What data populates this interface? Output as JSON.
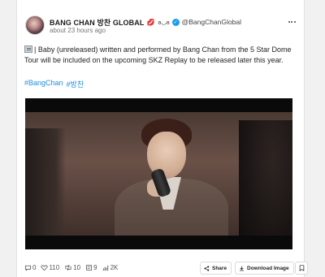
{
  "post": {
    "author": {
      "name": "BANG CHAN 방찬 GLOBAL",
      "lips_emoji": "💋",
      "name_suffix": "ʚ◡ɞ",
      "handle": "@BangChanGlobal"
    },
    "timestamp": "about 23 hours ago",
    "text": "| Baby (unreleased) written and performed by Bang Chan from the 5 Star Dome Tour will be included on the upcoming SKZ Replay to be released later this year.",
    "hashtags": [
      "#BangChan",
      "#방찬"
    ]
  },
  "stats": {
    "replies": "0",
    "likes": "110",
    "reposts": "10",
    "quotes": "9",
    "views": "2K"
  },
  "buttons": {
    "share": "Share",
    "download": "Download Image"
  },
  "colors": {
    "accent": "#1d8fe0",
    "verified": "#1d9bf0"
  },
  "icons": [
    "avatar",
    "lips-icon",
    "verified-icon",
    "more-icon",
    "newspaper-icon",
    "reply-icon",
    "heart-icon",
    "repost-icon",
    "quote-icon",
    "views-icon",
    "share-icon",
    "download-icon",
    "bookmark-icon"
  ]
}
